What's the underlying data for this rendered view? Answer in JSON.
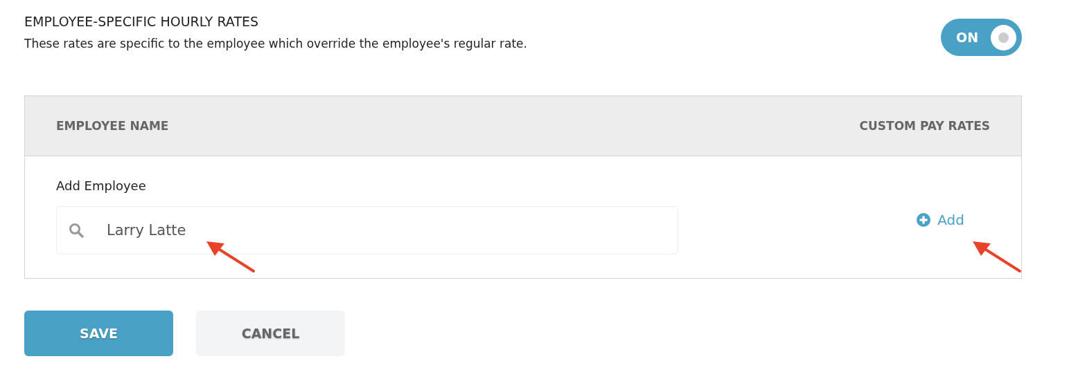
{
  "section": {
    "title": "EMPLOYEE-SPECIFIC HOURLY RATES",
    "description": "These rates are specific to the employee which override the employee's regular rate."
  },
  "toggle": {
    "label": "ON",
    "on": true
  },
  "table": {
    "columns": [
      "EMPLOYEE NAME",
      "CUSTOM PAY RATES"
    ],
    "add_employee": {
      "label": "Add Employee",
      "search_value": "Larry Latte"
    },
    "add_link": "Add"
  },
  "buttons": [
    {
      "label": "SAVE",
      "kind": "primary"
    },
    {
      "label": "CANCEL",
      "kind": "secondary"
    }
  ]
}
